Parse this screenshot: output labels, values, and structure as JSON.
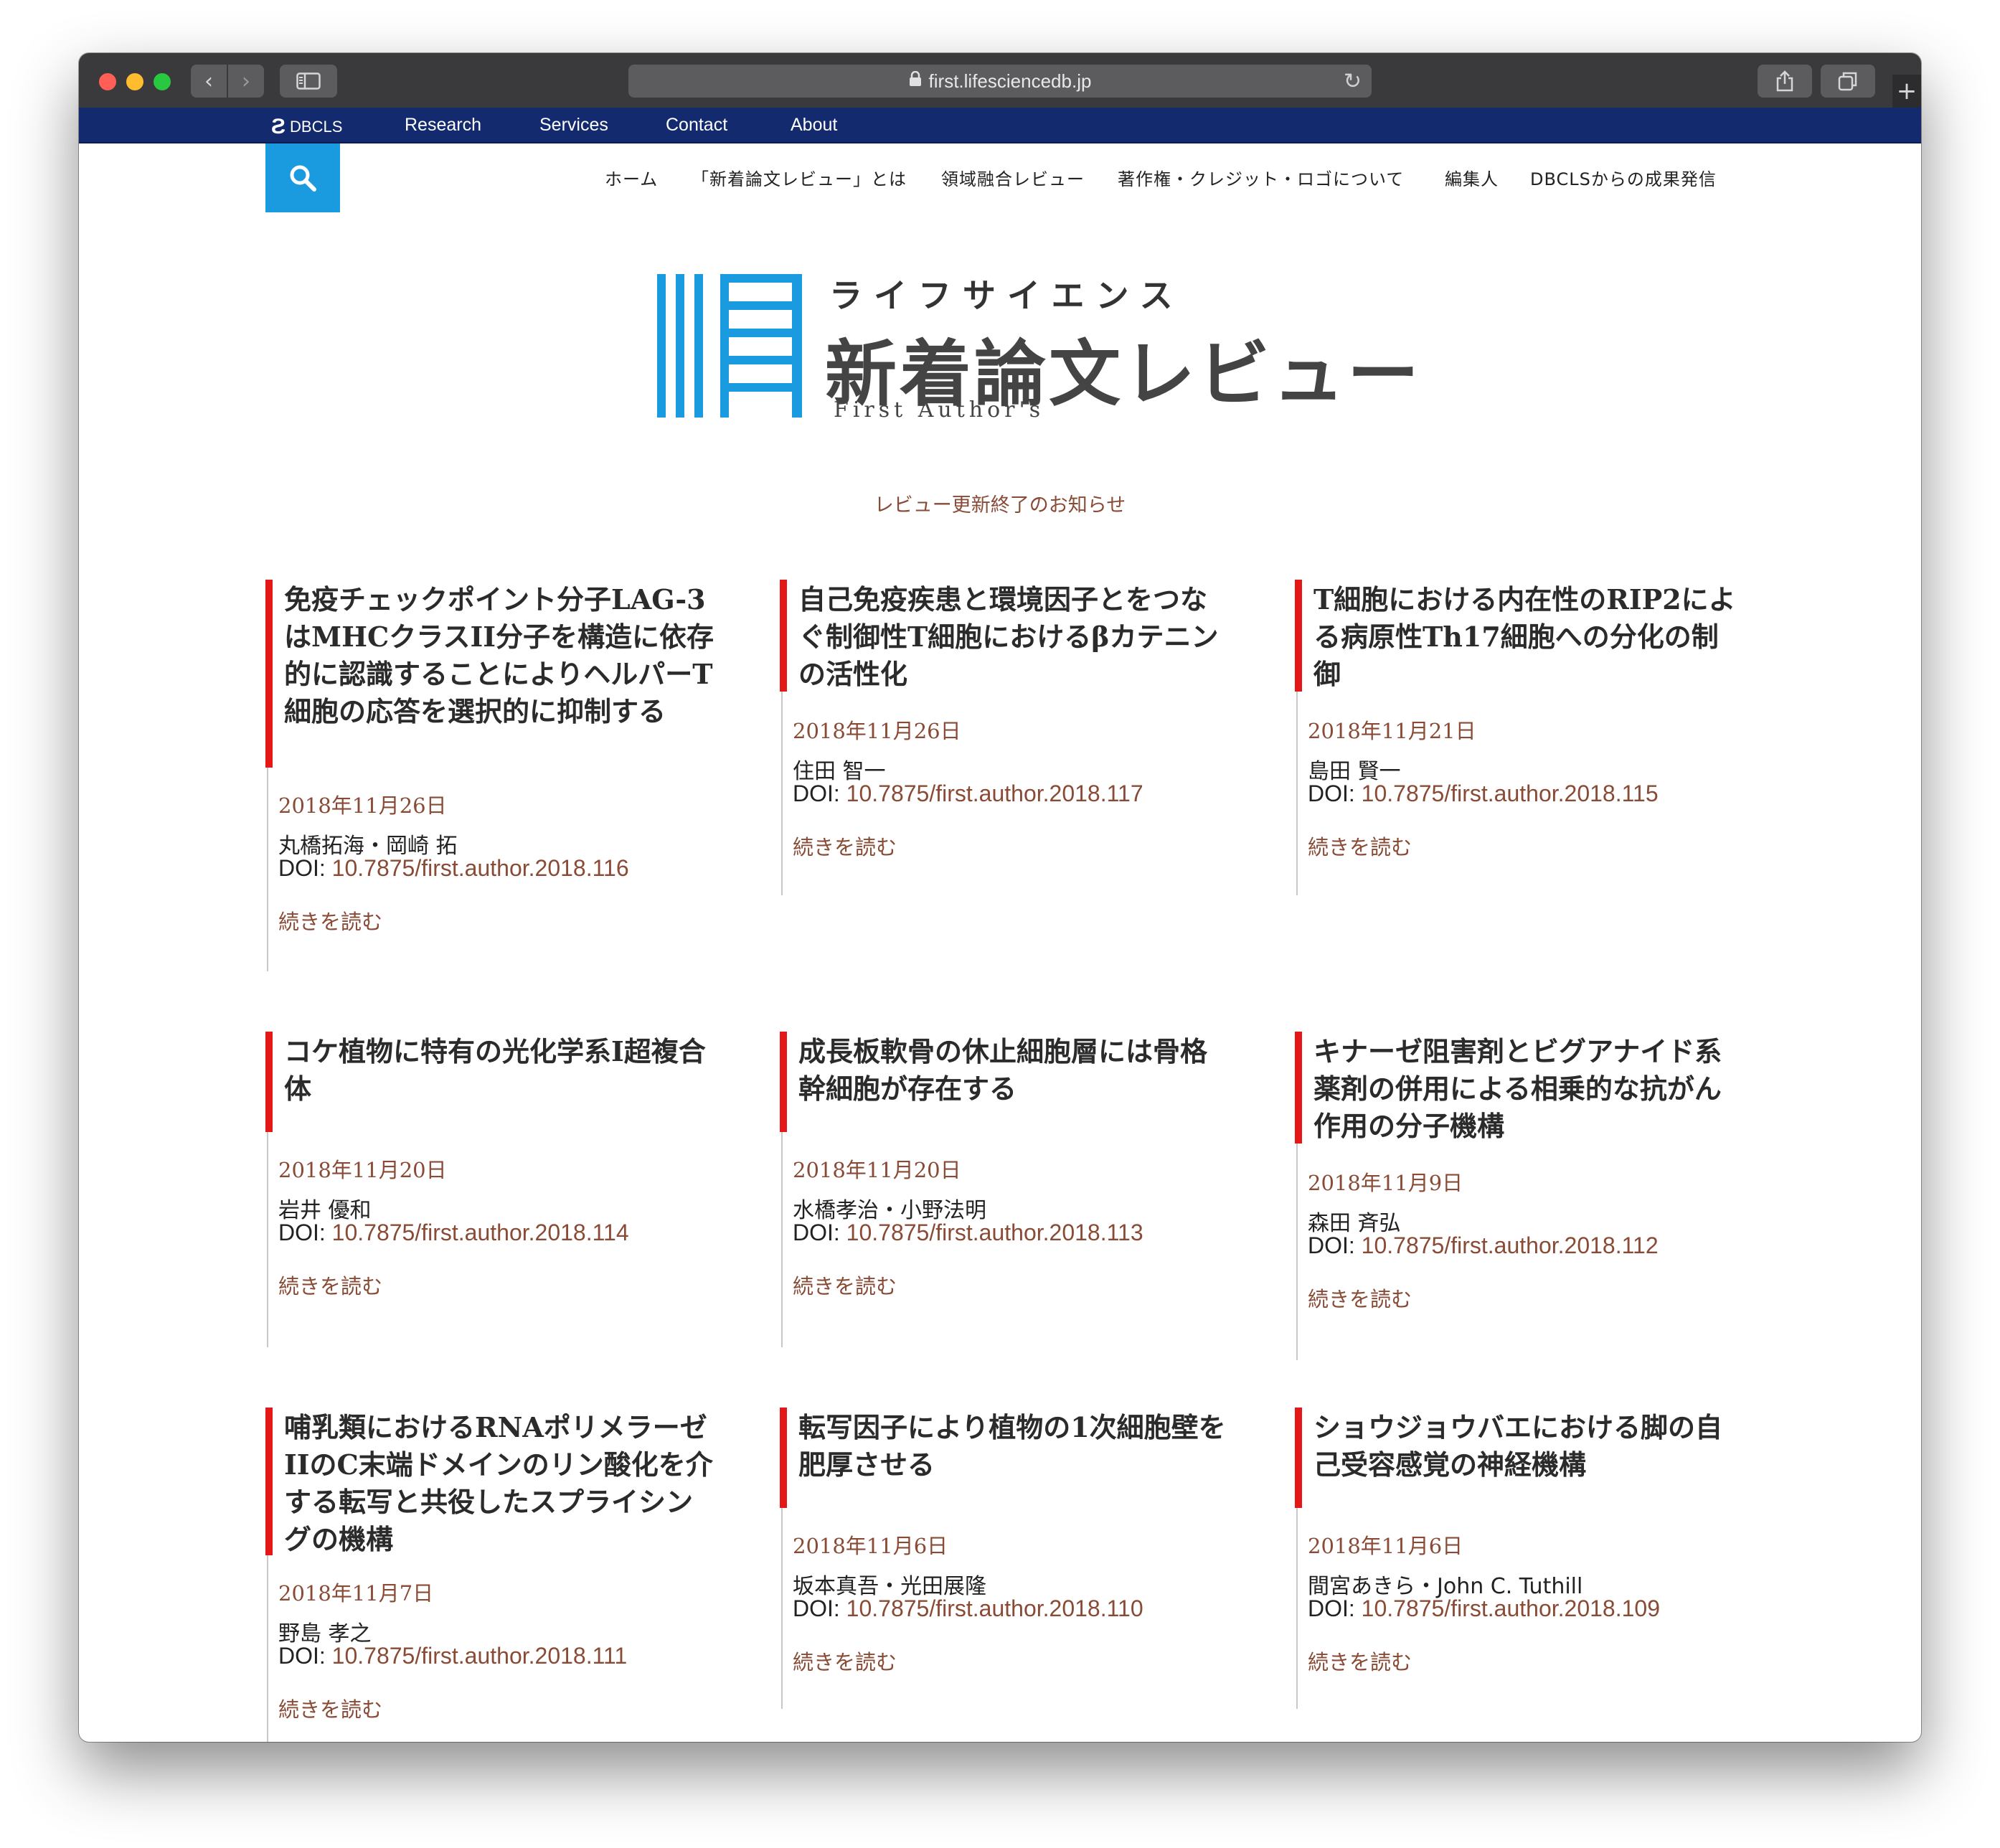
{
  "browser": {
    "url": "first.lifesciencedb.jp",
    "new_tab_glyph": "+"
  },
  "dbcls_bar": {
    "logo": "DBCLS",
    "nav": [
      "Research",
      "Services",
      "Contact",
      "About"
    ]
  },
  "site_nav": [
    "ホーム",
    "「新着論文レビュー」とは",
    "領域融合レビュー",
    "著作権・クレジット・ロゴについて",
    "編集人",
    "DBCLSからの成果発信"
  ],
  "logo": {
    "kana": "ライフサイエンス",
    "main": "新着論文レビュー",
    "english": "First Author's"
  },
  "notice": "レビュー更新終了のお知らせ",
  "read_more": "続きを読む",
  "doi_prefix": "DOI: ",
  "articles": [
    {
      "title": "免疫チェックポイント分子LAG-3はMHCクラスII分子を構造に依存的に認識することによりヘルパーT細胞の応答を選択的に抑制する",
      "date": "2018年11月26日",
      "authors": "丸橋拓海・岡崎 拓",
      "doi": "10.7875/first.author.2018.116"
    },
    {
      "title": "自己免疫疾患と環境因子とをつなぐ制御性T細胞におけるβカテニンの活性化",
      "date": "2018年11月26日",
      "authors": "住田 智一",
      "doi": "10.7875/first.author.2018.117"
    },
    {
      "title": "T細胞における内在性のRIP2による病原性Th17細胞への分化の制御",
      "date": "2018年11月21日",
      "authors": "島田 賢一",
      "doi": "10.7875/first.author.2018.115"
    },
    {
      "title": "コケ植物に特有の光化学系I超複合体",
      "date": "2018年11月20日",
      "authors": "岩井 優和",
      "doi": "10.7875/first.author.2018.114"
    },
    {
      "title": "成長板軟骨の休止細胞層には骨格幹細胞が存在する",
      "date": "2018年11月20日",
      "authors": "水橋孝治・小野法明",
      "doi": "10.7875/first.author.2018.113"
    },
    {
      "title": "キナーゼ阻害剤とビグアナイド系薬剤の併用による相乗的な抗がん作用の分子機構",
      "date": "2018年11月9日",
      "authors": "森田 斉弘",
      "doi": "10.7875/first.author.2018.112"
    },
    {
      "title": "哺乳類におけるRNAポリメラーゼIIのC末端ドメインのリン酸化を介する転写と共役したスプライシングの機構",
      "date": "2018年11月7日",
      "authors": "野島 孝之",
      "doi": "10.7875/first.author.2018.111"
    },
    {
      "title": "転写因子により植物の1次細胞壁を肥厚させる",
      "date": "2018年11月6日",
      "authors": "坂本真吾・光田展隆",
      "doi": "10.7875/first.author.2018.110"
    },
    {
      "title": "ショウジョウバエにおける脚の自己受容感覚の神経機構",
      "date": "2018年11月6日",
      "authors": "間宮あきら・John C. Tuthill",
      "doi": "10.7875/first.author.2018.109"
    }
  ],
  "colors": {
    "accent_red": "#e51818",
    "link_brown": "#8a4b36",
    "logo_blue": "#1a9be0",
    "dbcls_navy": "#142a6e"
  },
  "icons": [
    "back-icon",
    "forward-icon",
    "sidebar-icon",
    "lock-icon",
    "reload-icon",
    "share-icon",
    "tabs-icon",
    "search-icon",
    "dbcls-logo-icon"
  ]
}
